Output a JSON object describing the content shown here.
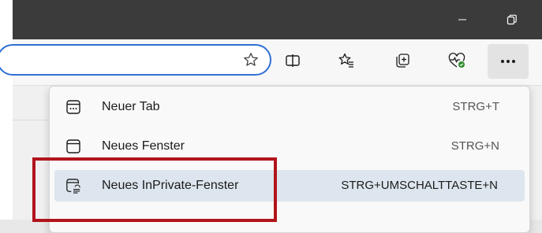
{
  "titlebar": {
    "minimize_icon": "minimize-icon",
    "restore_icon": "restore-icon"
  },
  "toolbar": {
    "icons": [
      "favorite-star-icon",
      "split-screen-icon",
      "favorites-icon",
      "collections-icon",
      "browser-essentials-icon",
      "more-icon"
    ]
  },
  "menu": {
    "items": [
      {
        "label": "Neuer Tab",
        "shortcut": "STRG+T",
        "icon": "new-tab-icon"
      },
      {
        "label": "Neues Fenster",
        "shortcut": "STRG+N",
        "icon": "new-window-icon"
      },
      {
        "label": "Neues InPrivate-Fenster",
        "shortcut": "STRG+UMSCHALTTASTE+N",
        "icon": "inprivate-window-icon",
        "selected": true
      }
    ]
  },
  "colors": {
    "titlebar": "#3b3b3b",
    "address_border": "#2f6fd6",
    "selected_item": "#dde6ee",
    "highlight_box": "#b2141c"
  }
}
